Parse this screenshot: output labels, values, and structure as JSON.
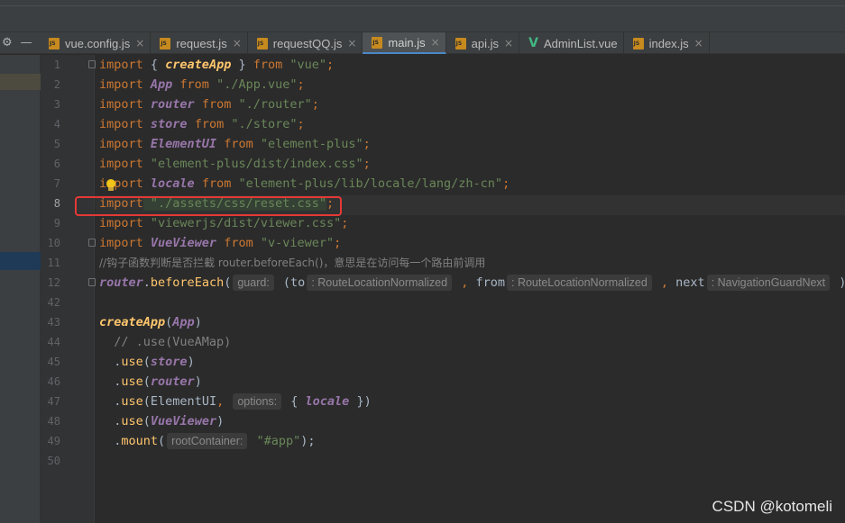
{
  "tool_icons": {
    "settings": "⚙",
    "minimize": "—"
  },
  "tabs": [
    {
      "label": "vue.config.js",
      "icon": "js-file-icon"
    },
    {
      "label": "request.js",
      "icon": "js-file-icon"
    },
    {
      "label": "requestQQ.js",
      "icon": "js-file-icon"
    },
    {
      "label": "main.js",
      "icon": "js-file-icon",
      "active": true
    },
    {
      "label": "api.js",
      "icon": "js-file-icon"
    },
    {
      "label": "AdminList.vue",
      "icon": "vue-file-icon"
    },
    {
      "label": "index.js",
      "icon": "js-file-icon"
    }
  ],
  "close_glyph": "×",
  "line_numbers": [
    "1",
    "2",
    "3",
    "4",
    "5",
    "6",
    "7",
    "8",
    "9",
    "10",
    "11",
    "12",
    "42",
    "43",
    "44",
    "45",
    "46",
    "47",
    "48",
    "49",
    "50"
  ],
  "code": {
    "l1": {
      "kw": "import",
      "a": " { ",
      "id": "createApp",
      "b": " } ",
      "kw2": "from",
      "str": " \"vue\"",
      "end": ";"
    },
    "l2": {
      "kw": "import",
      "id": " App ",
      "kw2": "from",
      "str": " \"./App.vue\"",
      "end": ";"
    },
    "l3": {
      "kw": "import",
      "id": " router ",
      "kw2": "from",
      "str": " \"./router\"",
      "end": ";"
    },
    "l4": {
      "kw": "import",
      "id": " store ",
      "kw2": "from",
      "str": " \"./store\"",
      "end": ";"
    },
    "l5": {
      "kw": "import",
      "id": " ElementUI ",
      "kw2": "from",
      "str": " \"element-plus\"",
      "end": ";"
    },
    "l6": {
      "kw": "import",
      "str": " \"element-plus/dist/index.css\"",
      "end": ";"
    },
    "l7": {
      "kw": "import",
      "id": " locale ",
      "kw2": "from",
      "str": " \"element-plus/lib/locale/lang/zh-cn\"",
      "end": ";"
    },
    "l8": {
      "kw": "import",
      "str": " \"./assets/css/reset.css\"",
      "end": ";"
    },
    "l9": {
      "kw": "import",
      "str": " \"viewerjs/dist/viewer.css\"",
      "end": ";"
    },
    "l10": {
      "kw": "import",
      "id": " VueViewer ",
      "kw2": "from",
      "str": " \"v-viewer\"",
      "end": ";"
    },
    "l11": {
      "comment": "//钩子函数判断是否拦截 router.beforeEach()，意思是在访问每一个路由前调用"
    },
    "l12": {
      "obj": "router",
      "dot": ".",
      "fn": "beforeEach",
      "paren": "(",
      "hint1": "guard:",
      "p1": " (to",
      "hint2": ": RouteLocationNormalized",
      "comma": " ,",
      "kw": " from",
      "hint3": ": RouteLocationNormalized",
      "comma2": " ,",
      "p3": " next",
      "hint4": ": NavigationGuardNext",
      "close": " )"
    },
    "l43": {
      "fn": "createApp",
      "open": "(",
      "arg": "App",
      "close": ")"
    },
    "l44": {
      "comment": "  // .use(VueAMap)"
    },
    "l45": {
      "pre": "  .",
      "fn": "use",
      "open": "(",
      "arg": "store",
      "close": ")"
    },
    "l46": {
      "pre": "  .",
      "fn": "use",
      "open": "(",
      "arg": "router",
      "close": ")"
    },
    "l47": {
      "pre": "  .",
      "fn": "use",
      "open": "(",
      "arg": "ElementUI",
      "comma": ",",
      "hint": "options:",
      "obj": " { ",
      "kw": "locale",
      "objclose": " })"
    },
    "l48": {
      "pre": "  .",
      "fn": "use",
      "open": "(",
      "arg": "VueViewer",
      "close": ")"
    },
    "l49": {
      "pre": "  .",
      "fn": "mount",
      "open": "(",
      "hint": "rootContainer:",
      "str": " \"#app\"",
      "close": ");"
    }
  },
  "watermark": "CSDN @kotomeli",
  "colors": {
    "keyword": "#cc7832",
    "string": "#6a8759",
    "comment": "#808080",
    "annotation_box": "#e53935",
    "accent": "#4a88c7"
  }
}
